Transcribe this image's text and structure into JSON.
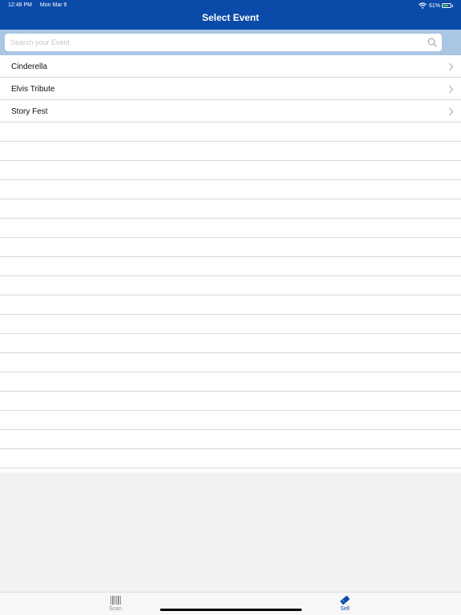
{
  "status": {
    "time": "12:48 PM",
    "date": "Mon Mar 9",
    "battery": "61%"
  },
  "header": {
    "title": "Select Event"
  },
  "search": {
    "placeholder": "Search your Event",
    "value": ""
  },
  "events": [
    "Cinderella",
    "Elvis Tribute",
    "Story Fest"
  ],
  "tabs": {
    "scan": "Scan",
    "sell": "Sell"
  },
  "colors": {
    "accent": "#0a4aa8",
    "search_bg": "#a9c6e3"
  },
  "icons": [
    "wifi-icon",
    "battery-icon",
    "search-icon",
    "chevron-right-icon",
    "barcode-icon",
    "ticket-icon"
  ]
}
